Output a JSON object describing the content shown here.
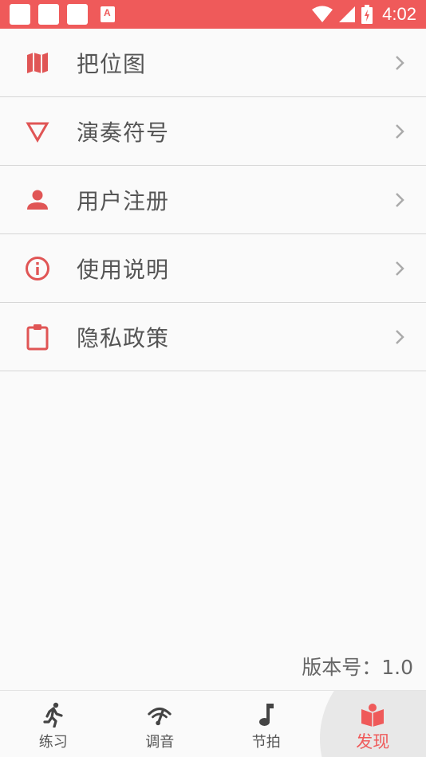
{
  "status_bar": {
    "time": "4:02",
    "background": "#ef5a5a"
  },
  "menu": {
    "items": [
      {
        "label": "把位图",
        "icon": "map-icon"
      },
      {
        "label": "演奏符号",
        "icon": "triangle-down-icon"
      },
      {
        "label": "用户注册",
        "icon": "person-icon"
      },
      {
        "label": "使用说明",
        "icon": "info-icon"
      },
      {
        "label": "隐私政策",
        "icon": "clipboard-icon"
      }
    ]
  },
  "version": "版本号：1.0",
  "bottom_nav": {
    "items": [
      {
        "label": "练习",
        "icon": "running-icon"
      },
      {
        "label": "调音",
        "icon": "tuner-icon"
      },
      {
        "label": "节拍",
        "icon": "music-note-icon"
      },
      {
        "label": "发现",
        "icon": "book-icon",
        "active": true
      }
    ]
  },
  "colors": {
    "accent": "#ef5a5a",
    "icon_red": "#e05555",
    "text": "#555555"
  }
}
